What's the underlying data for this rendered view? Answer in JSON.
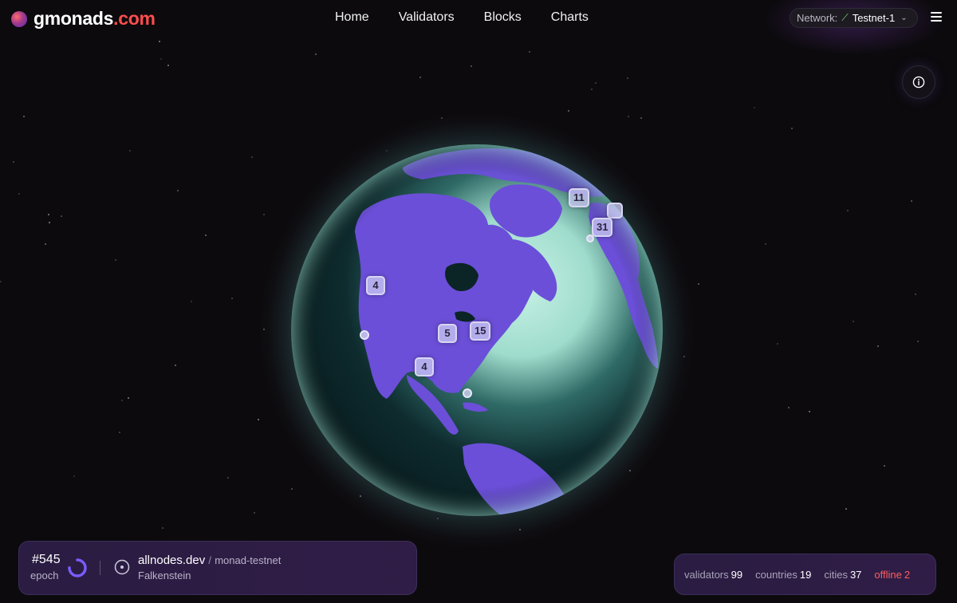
{
  "header": {
    "brand_name": "gmonads",
    "brand_tld": ".com",
    "nav": [
      {
        "label": "Home"
      },
      {
        "label": "Validators"
      },
      {
        "label": "Blocks"
      },
      {
        "label": "Charts"
      }
    ],
    "network_label": "Network:",
    "network_value": "Testnet-1"
  },
  "globe": {
    "clusters": [
      "11",
      "31",
      "4",
      "5",
      "15",
      "4"
    ]
  },
  "epoch": {
    "number": "#545",
    "label": "epoch",
    "progress": 0.75
  },
  "validator": {
    "name": "allnodes.dev",
    "separator": "/",
    "network": "monad-testnet",
    "city": "Falkenstein"
  },
  "stats": {
    "validators_label": "validators",
    "validators_value": "99",
    "countries_label": "countries",
    "countries_value": "19",
    "cities_label": "cities",
    "cities_value": "37",
    "offline_label": "offline",
    "offline_value": "2"
  },
  "colors": {
    "accent": "#ff4d4d",
    "land": "#6b4fd8",
    "ocean_light": "#9ee0cf",
    "ocean_dark": "#0d2a2c",
    "offline": "#ff5d5d"
  }
}
